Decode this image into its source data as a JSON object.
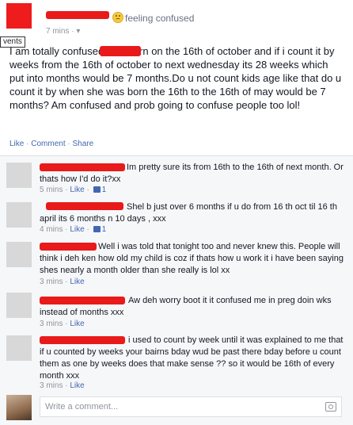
{
  "post": {
    "feeling": "feeling confused",
    "time": "7 mins",
    "tooltip": "vents",
    "text": "I am totally confused                was born on the 16th of october and if i count it by weeks from the 16th of october to next wednesday its 28 weeks which put into months would be 7 months.Do u not count kids age like that do u count it by when she was born the 16th to the 16th of may would be 7 months? Am confused and prob going to confuse people too lol!",
    "actions": {
      "like": "Like",
      "comment": "Comment",
      "share": "Share"
    }
  },
  "comments": [
    {
      "text": "Im pretty sure its from 16th to the 16th of next month. Or thats how I'd do it?xx",
      "time": "5 mins",
      "like": "Like",
      "likes": "1"
    },
    {
      "text": "Shel b just over 6 months if u do from 16 th oct til 16 th april its 6 months n 10 days , xxx",
      "time": "4 mins",
      "like": "Like",
      "likes": "1"
    },
    {
      "text": "Well i was told that tonight too and never knew this. People will think i deh ken how old my child is coz if thats how u work it i have been saying shes nearly a month older than she really is lol xx",
      "time": "3 mins",
      "like": "Like"
    },
    {
      "text": "Aw deh worry boot it it confused me in preg doin wks instead of months xxx",
      "time": "3 mins",
      "like": "Like"
    },
    {
      "text": "i used to count by week until it was explained to me that if u counted by weeks your bairns bday wud be past there bday before u count them as one by weeks does that make sense ?? so it would be 16th of every month xxx",
      "time": "3 mins",
      "like": "Like"
    }
  ],
  "composer": {
    "placeholder": "Write a comment..."
  },
  "colors": {
    "redaction": "#e81a1a",
    "link": "#4267b2"
  }
}
